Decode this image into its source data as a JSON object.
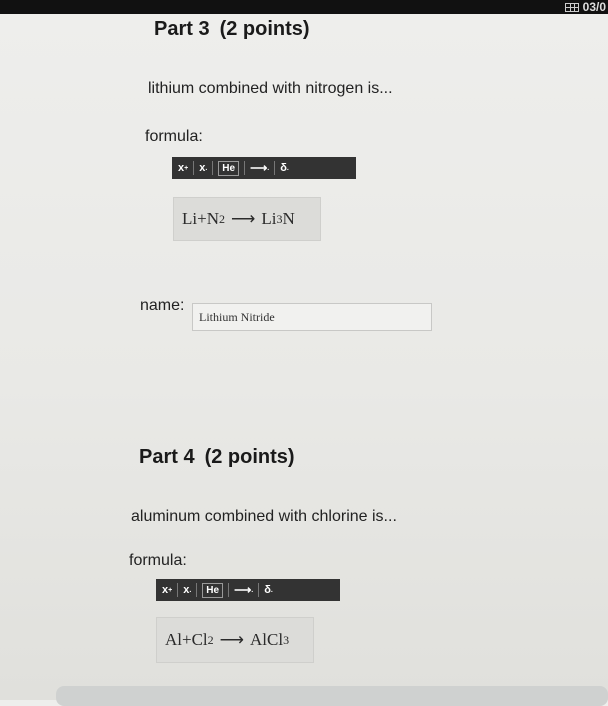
{
  "corner": {
    "date": "03/0"
  },
  "part3": {
    "heading": "Part 3",
    "points": "(2 points)",
    "question": "lithium combined with nitrogen is...",
    "formula_label": "formula:",
    "toolbar": {
      "superscript": "x",
      "subscript": "x",
      "element": "He",
      "arrow": "⟶",
      "delta": "δ"
    },
    "equation": {
      "reactant1": "Li",
      "plus": "+",
      "reactant2": "N",
      "reactant2_sub": "2",
      "product": "Li",
      "product_sub": "3",
      "product_tail": "N"
    },
    "name_label": "name:",
    "name_value": "Lithium Nitride"
  },
  "part4": {
    "heading": "Part 4",
    "points": "(2 points)",
    "question": "aluminum combined with chlorine is...",
    "formula_label": "formula:",
    "toolbar": {
      "superscript": "x",
      "subscript": "x",
      "element": "He",
      "arrow": "⟶",
      "delta": "δ"
    },
    "equation": {
      "reactant1": "Al",
      "plus": "+",
      "reactant2": "Cl",
      "reactant2_sub": "2",
      "product": "AlCl",
      "product_sub": "3"
    }
  }
}
